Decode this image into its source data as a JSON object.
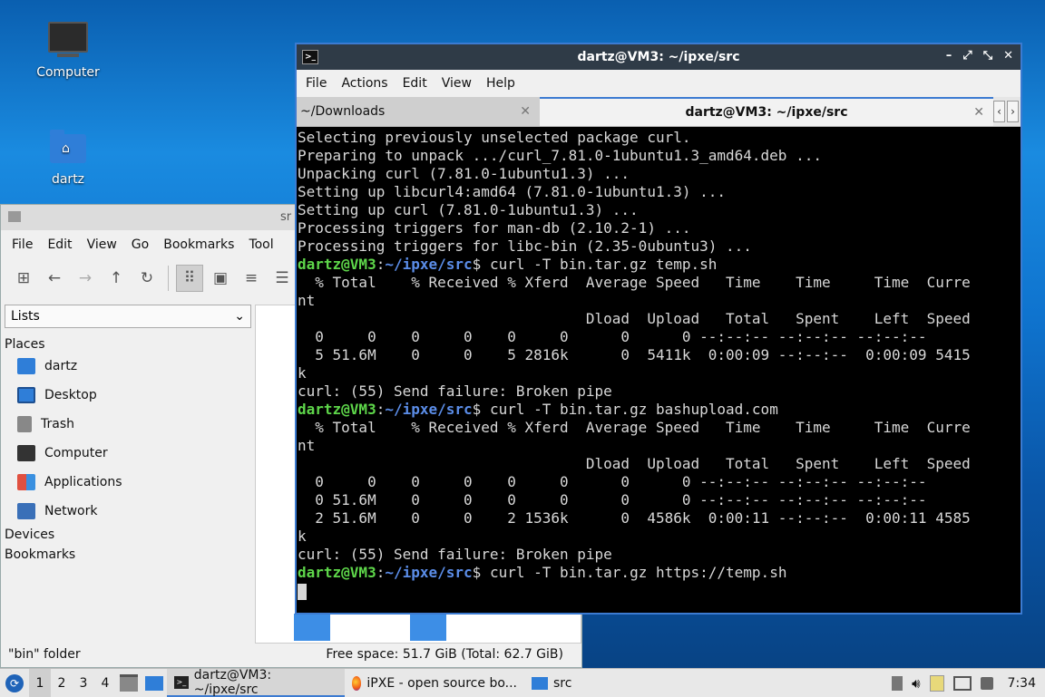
{
  "desktop": {
    "icons": [
      {
        "label": "Computer",
        "icon": "computer-icon"
      },
      {
        "label": "dartz",
        "icon": "home-folder-icon"
      }
    ]
  },
  "file_manager": {
    "title": "sr",
    "menu": [
      "File",
      "Edit",
      "View",
      "Go",
      "Bookmarks",
      "Tool"
    ],
    "side_select": "Lists",
    "places_heading": "Places",
    "places": [
      {
        "label": "dartz",
        "icon": "home-folder-icon",
        "color": "#2f7ed8"
      },
      {
        "label": "Desktop",
        "icon": "desktop-icon",
        "color": "#2f7ed8"
      },
      {
        "label": "Trash",
        "icon": "trash-icon",
        "color": "#888888"
      },
      {
        "label": "Computer",
        "icon": "computer-icon",
        "color": "#333333"
      },
      {
        "label": "Applications",
        "icon": "applications-icon",
        "color": "#e05040"
      },
      {
        "label": "Network",
        "icon": "network-icon",
        "color": "#3a70b8"
      }
    ],
    "devices_heading": "Devices",
    "bookmarks_heading": "Bookmarks",
    "status_left": "\"bin\" folder",
    "status_right": "Free space: 51.7 GiB (Total: 62.7 GiB)"
  },
  "terminal": {
    "title": "dartz@VM3: ~/ipxe/src",
    "menu": [
      "File",
      "Actions",
      "Edit",
      "View",
      "Help"
    ],
    "tabs": [
      {
        "label": "~/Downloads",
        "active": false
      },
      {
        "label": "dartz@VM3: ~/ipxe/src",
        "active": true
      }
    ],
    "lines": [
      {
        "text": "Selecting previously unselected package curl."
      },
      {
        "text": "Preparing to unpack .../curl_7.81.0-1ubuntu1.3_amd64.deb ..."
      },
      {
        "text": "Unpacking curl (7.81.0-1ubuntu1.3) ..."
      },
      {
        "text": "Setting up libcurl4:amd64 (7.81.0-1ubuntu1.3) ..."
      },
      {
        "text": "Setting up curl (7.81.0-1ubuntu1.3) ..."
      },
      {
        "text": "Processing triggers for man-db (2.10.2-1) ..."
      },
      {
        "text": "Processing triggers for libc-bin (2.35-0ubuntu3) ..."
      },
      {
        "user": "dartz@VM3",
        "path": "~/ipxe/src",
        "cmd": "$ curl -T bin.tar.gz temp.sh"
      },
      {
        "text": "  % Total    % Received % Xferd  Average Speed   Time    Time     Time  Curre"
      },
      {
        "text": "nt"
      },
      {
        "text": "                                 Dload  Upload   Total   Spent    Left  Speed"
      },
      {
        "text": "  0     0    0     0    0     0      0      0 --:--:-- --:--:-- --:--:--"
      },
      {
        "text": "  5 51.6M    0     0    5 2816k      0  5411k  0:00:09 --:--:--  0:00:09 5415"
      },
      {
        "text": "k"
      },
      {
        "text": "curl: (55) Send failure: Broken pipe"
      },
      {
        "user": "dartz@VM3",
        "path": "~/ipxe/src",
        "cmd": "$ curl -T bin.tar.gz bashupload.com"
      },
      {
        "text": "  % Total    % Received % Xferd  Average Speed   Time    Time     Time  Curre"
      },
      {
        "text": "nt"
      },
      {
        "text": "                                 Dload  Upload   Total   Spent    Left  Speed"
      },
      {
        "text": "  0     0    0     0    0     0      0      0 --:--:-- --:--:-- --:--:--"
      },
      {
        "text": "  0 51.6M    0     0    0     0      0      0 --:--:-- --:--:-- --:--:--"
      },
      {
        "text": "  2 51.6M    0     0    2 1536k      0  4586k  0:00:11 --:--:--  0:00:11 4585"
      },
      {
        "text": "k"
      },
      {
        "text": "curl: (55) Send failure: Broken pipe"
      },
      {
        "user": "dartz@VM3",
        "path": "~/ipxe/src",
        "cmd": "$ curl -T bin.tar.gz https://temp.sh"
      }
    ],
    "colors": {
      "user": "#5ed64a",
      "path": "#5b8de8",
      "border": "#3c7bd1"
    }
  },
  "taskbar": {
    "desktops": [
      "1",
      "2",
      "3",
      "4"
    ],
    "tasks": [
      {
        "label": "dartz@VM3: ~/ipxe/src",
        "icon": "terminal-icon",
        "active": true
      },
      {
        "label": "iPXE - open source bo...",
        "icon": "firefox-icon",
        "active": false
      },
      {
        "label": "src",
        "icon": "folder-icon",
        "active": false
      }
    ],
    "clock": "7:34"
  }
}
